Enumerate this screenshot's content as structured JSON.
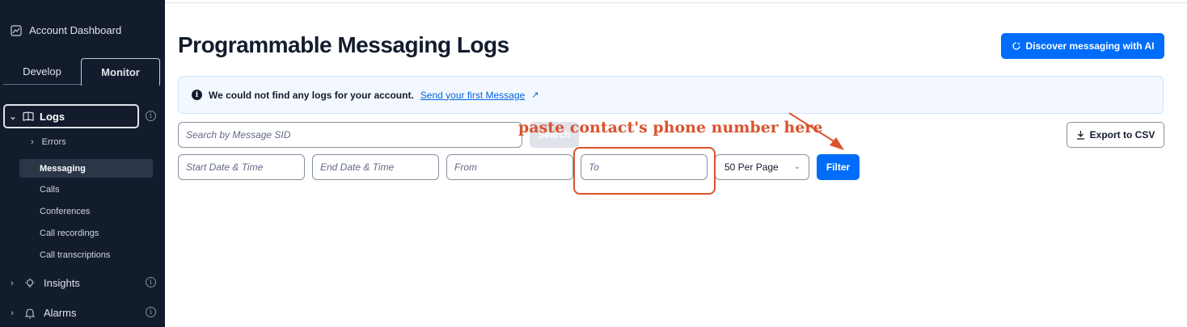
{
  "sidebar": {
    "account_dashboard": "Account Dashboard",
    "tabs": [
      {
        "label": "Develop",
        "active": false
      },
      {
        "label": "Monitor",
        "active": true
      }
    ],
    "logs_label": "Logs",
    "errors_label": "Errors",
    "sub_items": [
      {
        "label": "Messaging",
        "active": true
      },
      {
        "label": "Calls",
        "active": false
      },
      {
        "label": "Conferences",
        "active": false
      },
      {
        "label": "Call recordings",
        "active": false
      },
      {
        "label": "Call transcriptions",
        "active": false
      }
    ],
    "insights_label": "Insights",
    "alarms_label": "Alarms"
  },
  "header": {
    "title": "Programmable Messaging Logs",
    "ai_button": "Discover messaging with AI"
  },
  "banner": {
    "message": "We could not find any logs for your account.",
    "link": "Send your first Message"
  },
  "search": {
    "placeholder": "Search by Message SID",
    "button": "Search"
  },
  "export_button": "Export to CSV",
  "filters": {
    "start_placeholder": "Start Date & Time",
    "end_placeholder": "End Date & Time",
    "from_placeholder": "From",
    "to_placeholder": "To",
    "per_page": "50 Per Page",
    "filter_button": "Filter"
  },
  "annotation": {
    "text": "paste contact's phone number here",
    "color": "#d9532e"
  },
  "colors": {
    "sidebar_bg": "#121c2d",
    "primary": "#006dfa",
    "annotation": "#d9532e"
  }
}
